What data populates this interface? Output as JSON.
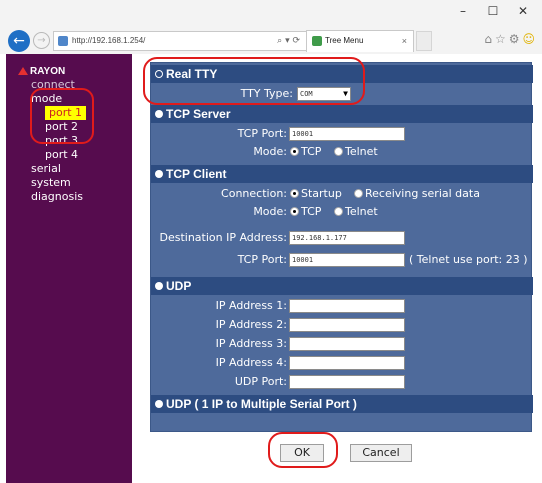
{
  "browser": {
    "window_controls": [
      "–",
      "☐",
      "✕"
    ],
    "url": "http://192.168.1.254/",
    "address_tools": "⌕ ▾ ⟳",
    "tab_title": "Tree Menu",
    "tab_close": "×",
    "toolbar_icons": [
      "home-icon",
      "star-icon",
      "gear-icon",
      "smiley-icon"
    ]
  },
  "sidebar": {
    "logo": "RAYON",
    "items": [
      {
        "label": "connect",
        "level": 0
      },
      {
        "label": "mode",
        "level": 0
      },
      {
        "label": "port 1",
        "level": 1,
        "selected": true
      },
      {
        "label": "port 2",
        "level": 1
      },
      {
        "label": "port 3",
        "level": 1
      },
      {
        "label": "port 4",
        "level": 1
      },
      {
        "label": "serial",
        "level": 0
      },
      {
        "label": "system",
        "level": 0
      },
      {
        "label": "diagnosis",
        "level": 0
      }
    ]
  },
  "form": {
    "real_tty": {
      "header": "Real TTY",
      "tty_type_label": "TTY Type:",
      "tty_type_value": "COM"
    },
    "tcp_server": {
      "header": "TCP Server",
      "port_label": "TCP Port:",
      "port_value": "10001",
      "mode_label": "Mode:",
      "mode_tcp": "TCP",
      "mode_telnet": "Telnet"
    },
    "tcp_client": {
      "header": "TCP Client",
      "connection_label": "Connection:",
      "conn_startup": "Startup",
      "conn_receiving": "Receiving serial data",
      "mode_label": "Mode:",
      "mode_tcp": "TCP",
      "mode_telnet": "Telnet",
      "dest_ip_label": "Destination IP Address:",
      "dest_ip_value": "192.168.1.177",
      "port_label": "TCP Port:",
      "port_value": "10001",
      "telnet_note": "( Telnet use port: 23 )"
    },
    "udp": {
      "header": "UDP",
      "ip1_label": "IP Address 1:",
      "ip2_label": "IP Address 2:",
      "ip3_label": "IP Address 3:",
      "ip4_label": "IP Address 4:",
      "udp_port_label": "UDP Port:"
    },
    "udp_multi": {
      "header": "UDP ( 1 IP to Multiple Serial Port )"
    }
  },
  "buttons": {
    "ok": "OK",
    "cancel": "Cancel"
  },
  "colors": {
    "sidebar_bg": "#560c4e",
    "panel_bg": "#4e6a9b",
    "header_bg": "#2d4c81",
    "annotation": "#e01b1b",
    "selected_bg": "#ffff00"
  }
}
